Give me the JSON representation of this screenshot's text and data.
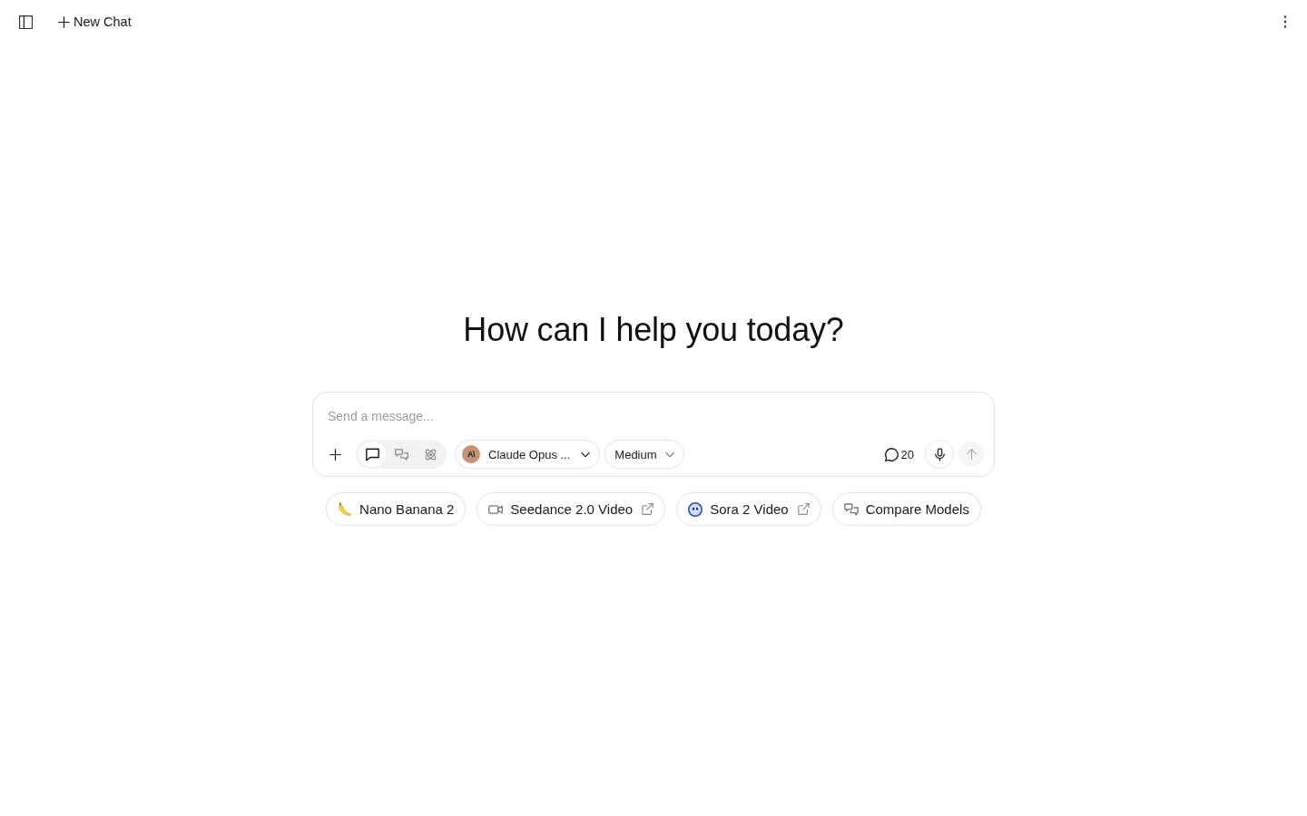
{
  "top_bar": {
    "new_chat": "New Chat"
  },
  "heading": "How can I help you today?",
  "composer": {
    "placeholder": "Send a message...",
    "modes": [
      {
        "selected": true
      },
      {
        "selected": false
      },
      {
        "selected": false
      }
    ],
    "model": {
      "logo": "A\\",
      "label": "Claude Opus ..."
    },
    "effort": "Medium",
    "message_count": "20",
    "send": {
      "disabled": true
    }
  },
  "suggestions": [
    {
      "label": "Nano Banana 2",
      "external": false
    },
    {
      "label": "Seedance 2.0 Video",
      "external": true
    },
    {
      "label": "Sora 2 Video",
      "external": true
    },
    {
      "label": "Compare Models",
      "external": false
    }
  ]
}
